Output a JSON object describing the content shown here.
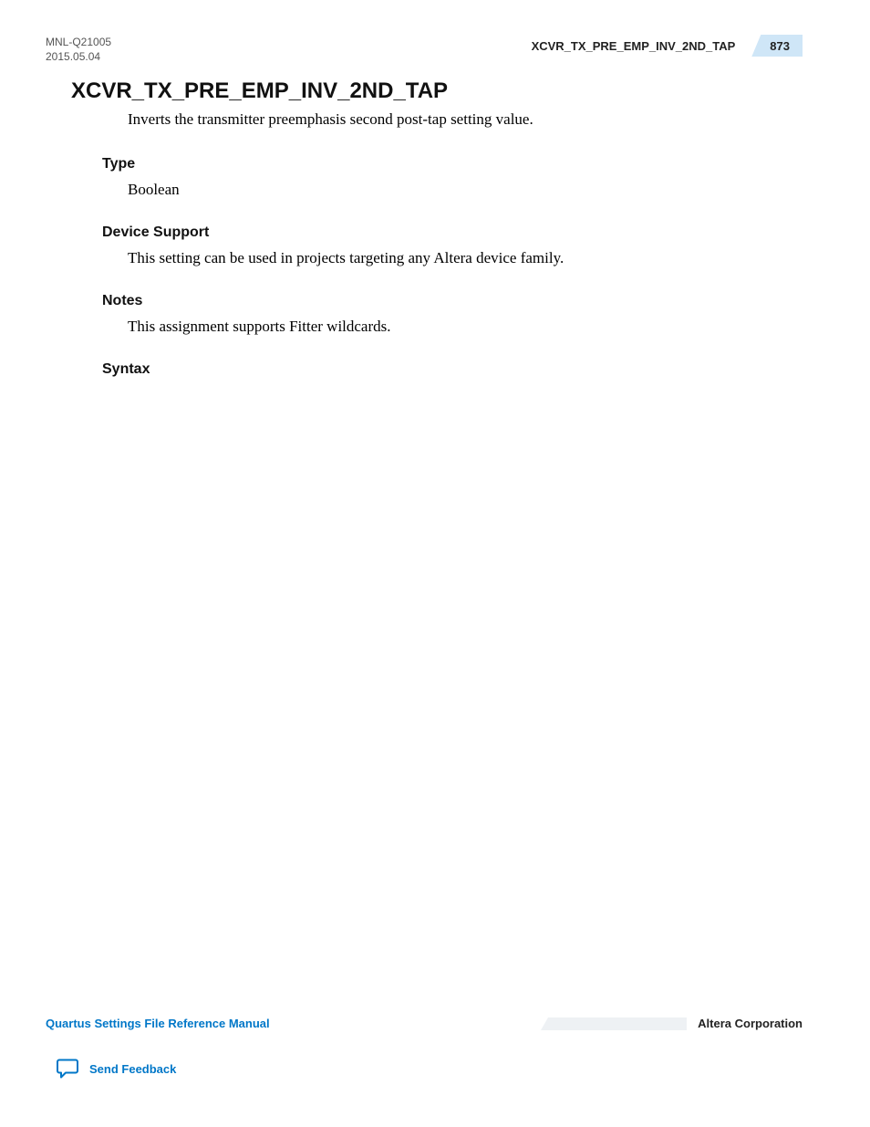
{
  "header": {
    "doc_id": "MNL-Q21005",
    "date": "2015.05.04",
    "running_title": "XCVR_TX_PRE_EMP_INV_2ND_TAP",
    "page_number": "873"
  },
  "content": {
    "title": "XCVR_TX_PRE_EMP_INV_2ND_TAP",
    "intro": "Inverts the transmitter preemphasis second post-tap setting value.",
    "sections": {
      "type": {
        "heading": "Type",
        "body": "Boolean"
      },
      "device_support": {
        "heading": "Device Support",
        "body": "This setting can be used in projects targeting any Altera device family."
      },
      "notes": {
        "heading": "Notes",
        "body": "This assignment supports Fitter wildcards."
      },
      "syntax": {
        "heading": "Syntax",
        "body": ""
      }
    }
  },
  "footer": {
    "manual_title": "Quartus Settings File Reference Manual",
    "company": "Altera Corporation",
    "feedback_label": "Send Feedback"
  }
}
